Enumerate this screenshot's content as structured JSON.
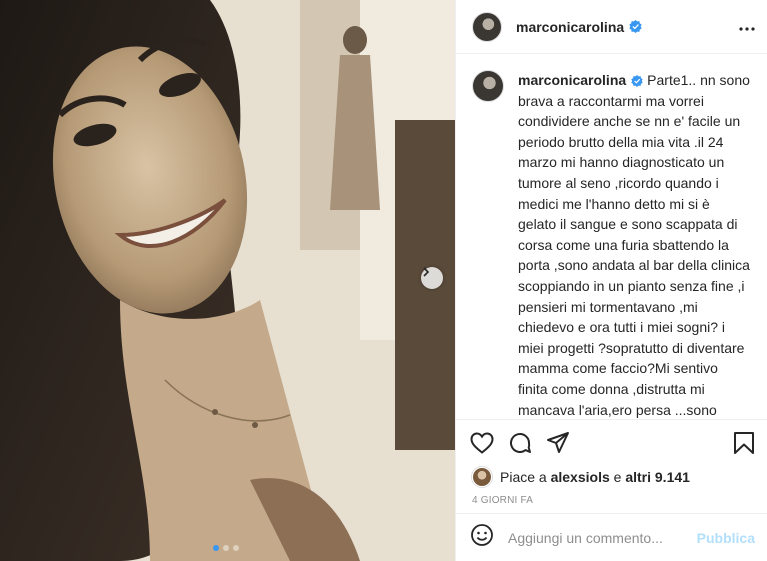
{
  "post": {
    "username": "marconicarolina",
    "verified": true,
    "caption_username": "marconicarolina",
    "caption_text": "Parte1.. nn sono brava a raccontarmi ma vorrei condividere anche se nn e' facile un periodo brutto della mia vita .il 24 marzo mi hanno diagnosticato un tumore al seno ,ricordo quando i medici me l'hanno detto mi si è gelato il sangue e sono scappata di corsa come una furia sbattendo la porta ,sono andata al bar della clinica scoppiando in un pianto senza fine ,i pensieri mi tormentavano ,mi chiedevo e ora tutti i miei sogni? i miei progetti ?sopratutto di diventare mamma come faccio?Mi sentivo finita come donna ,distrutta mi mancava l'aria,ero persa ...sono diventata rossa come un peperoncino anche se nn si vedeva vabe sono scurotta🤗 , mi sono",
    "likes_prefix": "Piace a ",
    "likes_user": "alexsiols",
    "likes_joiner": " e ",
    "likes_others": "altri 9.141",
    "time_ago": "4 giorni fa",
    "comment_placeholder": "Aggiungi un commento...",
    "publish_label": "Pubblica",
    "carousel": {
      "total": 3,
      "current": 1
    }
  },
  "icons": {
    "more": "more-horizontal-icon",
    "like": "heart-icon",
    "comment": "comment-icon",
    "share": "paper-plane-icon",
    "save": "bookmark-icon",
    "emoji": "emoji-icon",
    "next": "chevron-right-icon",
    "verified": "verified-badge-icon"
  },
  "colors": {
    "verified": "#3897f0",
    "publish_disabled": "#b2dffc",
    "muted": "#8e8e8e",
    "text": "#262626"
  }
}
